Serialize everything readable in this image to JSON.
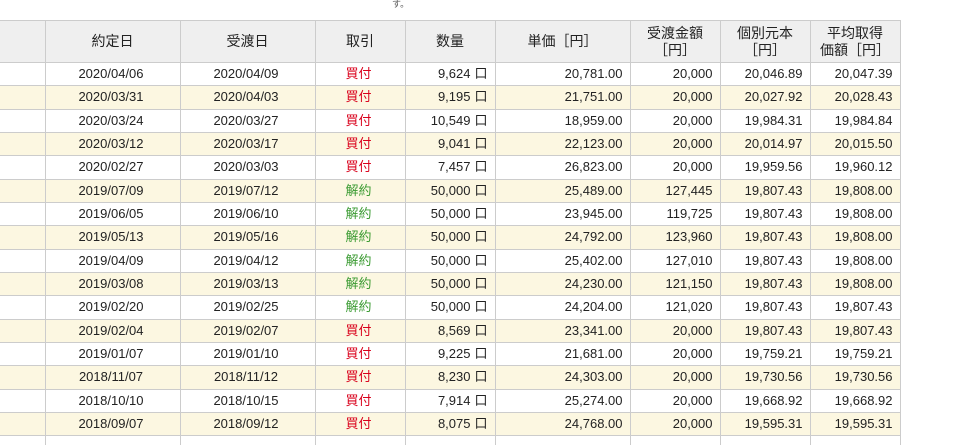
{
  "caption_fragment": "す。",
  "colors": {
    "transaction_type": {
      "買付": "#d9001b",
      "解約": "#3b9b32"
    }
  },
  "table": {
    "headers": {
      "trade_date": [
        "約定日"
      ],
      "settle_date": [
        "受渡日"
      ],
      "type": [
        "取引"
      ],
      "qty": [
        "数量"
      ],
      "price": [
        "単価［円］"
      ],
      "amount": [
        "受渡金額",
        "［円］"
      ],
      "principal": [
        "個別元本",
        "［円］"
      ],
      "avg_cost": [
        "平均取得",
        "価額［円］"
      ]
    },
    "qty_unit": "口",
    "rows": [
      {
        "trade_date": "2020/04/06",
        "settle_date": "2020/04/09",
        "type": "買付",
        "qty": "9,624",
        "price": "20,781.00",
        "amount": "20,000",
        "principal": "20,046.89",
        "avg_cost": "20,047.39"
      },
      {
        "trade_date": "2020/03/31",
        "settle_date": "2020/04/03",
        "type": "買付",
        "qty": "9,195",
        "price": "21,751.00",
        "amount": "20,000",
        "principal": "20,027.92",
        "avg_cost": "20,028.43"
      },
      {
        "trade_date": "2020/03/24",
        "settle_date": "2020/03/27",
        "type": "買付",
        "qty": "10,549",
        "price": "18,959.00",
        "amount": "20,000",
        "principal": "19,984.31",
        "avg_cost": "19,984.84"
      },
      {
        "trade_date": "2020/03/12",
        "settle_date": "2020/03/17",
        "type": "買付",
        "qty": "9,041",
        "price": "22,123.00",
        "amount": "20,000",
        "principal": "20,014.97",
        "avg_cost": "20,015.50"
      },
      {
        "trade_date": "2020/02/27",
        "settle_date": "2020/03/03",
        "type": "買付",
        "qty": "7,457",
        "price": "26,823.00",
        "amount": "20,000",
        "principal": "19,959.56",
        "avg_cost": "19,960.12"
      },
      {
        "trade_date": "2019/07/09",
        "settle_date": "2019/07/12",
        "type": "解約",
        "qty": "50,000",
        "price": "25,489.00",
        "amount": "127,445",
        "principal": "19,807.43",
        "avg_cost": "19,808.00"
      },
      {
        "trade_date": "2019/06/05",
        "settle_date": "2019/06/10",
        "type": "解約",
        "qty": "50,000",
        "price": "23,945.00",
        "amount": "119,725",
        "principal": "19,807.43",
        "avg_cost": "19,808.00"
      },
      {
        "trade_date": "2019/05/13",
        "settle_date": "2019/05/16",
        "type": "解約",
        "qty": "50,000",
        "price": "24,792.00",
        "amount": "123,960",
        "principal": "19,807.43",
        "avg_cost": "19,808.00"
      },
      {
        "trade_date": "2019/04/09",
        "settle_date": "2019/04/12",
        "type": "解約",
        "qty": "50,000",
        "price": "25,402.00",
        "amount": "127,010",
        "principal": "19,807.43",
        "avg_cost": "19,808.00"
      },
      {
        "trade_date": "2019/03/08",
        "settle_date": "2019/03/13",
        "type": "解約",
        "qty": "50,000",
        "price": "24,230.00",
        "amount": "121,150",
        "principal": "19,807.43",
        "avg_cost": "19,808.00"
      },
      {
        "trade_date": "2019/02/20",
        "settle_date": "2019/02/25",
        "type": "解約",
        "qty": "50,000",
        "price": "24,204.00",
        "amount": "121,020",
        "principal": "19,807.43",
        "avg_cost": "19,807.43"
      },
      {
        "trade_date": "2019/02/04",
        "settle_date": "2019/02/07",
        "type": "買付",
        "qty": "8,569",
        "price": "23,341.00",
        "amount": "20,000",
        "principal": "19,807.43",
        "avg_cost": "19,807.43"
      },
      {
        "trade_date": "2019/01/07",
        "settle_date": "2019/01/10",
        "type": "買付",
        "qty": "9,225",
        "price": "21,681.00",
        "amount": "20,000",
        "principal": "19,759.21",
        "avg_cost": "19,759.21"
      },
      {
        "trade_date": "2018/11/07",
        "settle_date": "2018/11/12",
        "type": "買付",
        "qty": "8,230",
        "price": "24,303.00",
        "amount": "20,000",
        "principal": "19,730.56",
        "avg_cost": "19,730.56"
      },
      {
        "trade_date": "2018/10/10",
        "settle_date": "2018/10/15",
        "type": "買付",
        "qty": "7,914",
        "price": "25,274.00",
        "amount": "20,000",
        "principal": "19,668.92",
        "avg_cost": "19,668.92"
      },
      {
        "trade_date": "2018/09/07",
        "settle_date": "2018/09/12",
        "type": "買付",
        "qty": "8,075",
        "price": "24,768.00",
        "amount": "20,000",
        "principal": "19,595.31",
        "avg_cost": "19,595.31"
      }
    ]
  }
}
